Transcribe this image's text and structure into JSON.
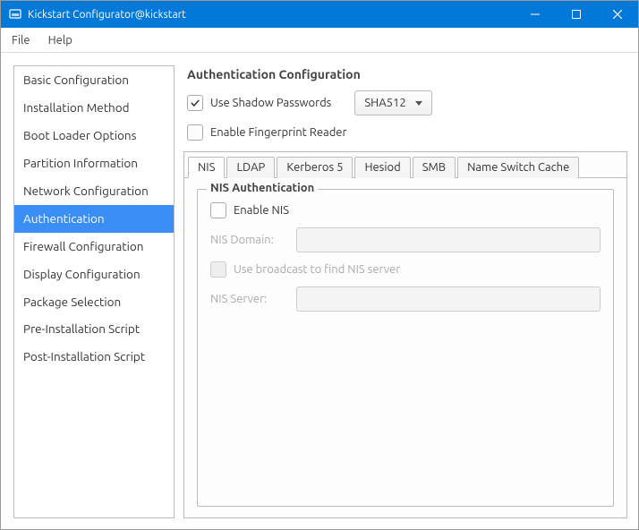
{
  "window": {
    "title": "Kickstart Configurator@kickstart"
  },
  "menu": {
    "file": "File",
    "help": "Help"
  },
  "sidebar": {
    "items": [
      "Basic Configuration",
      "Installation Method",
      "Boot Loader Options",
      "Partition Information",
      "Network Configuration",
      "Authentication",
      "Firewall Configuration",
      "Display Configuration",
      "Package Selection",
      "Pre-Installation Script",
      "Post-Installation Script"
    ],
    "selected_index": 5
  },
  "content": {
    "title": "Authentication Configuration",
    "shadow_label": "Use Shadow Passwords",
    "shadow_checked": true,
    "hash_value": "SHA512",
    "fingerprint_label": "Enable Fingerprint Reader",
    "fingerprint_checked": false,
    "tabs": [
      "NIS",
      "LDAP",
      "Kerberos 5",
      "Hesiod",
      "SMB",
      "Name Switch Cache"
    ],
    "active_tab": 0,
    "nis": {
      "legend": "NIS Authentication",
      "enable_label": "Enable NIS",
      "enable_checked": false,
      "domain_label": "NIS Domain:",
      "domain_value": "",
      "broadcast_label": "Use broadcast to find NIS server",
      "broadcast_checked": false,
      "server_label": "NIS Server:",
      "server_value": ""
    }
  }
}
